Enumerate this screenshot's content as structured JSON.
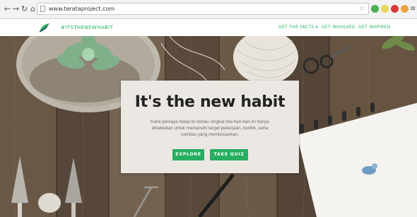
{
  "browser": {
    "url": "www.terataproject.com"
  },
  "header": {
    "brand": "#ITSTHENEWHABIT",
    "nav": [
      "GET THE FACTS ▾",
      "GET INVOLVED",
      "GET INSPIRED"
    ]
  },
  "hero": {
    "title": "It's the new habit",
    "body_lines": [
      "Kami percaya hidup ini terlalu singkat bila hari-hari ini hanya",
      "dihabiskan untuk memenuhi target pekerjaan, konflik, serta",
      "rutinitas yang membosankan."
    ],
    "explore_label": "EXPLORE",
    "quiz_label": "TAKE QUIZ"
  },
  "icons": {
    "back": "back-arrow-icon",
    "forward": "forward-arrow-icon",
    "reload": "reload-icon",
    "home": "home-icon",
    "bookmark": "star-icon",
    "menu": "menu-icon"
  },
  "colors": {
    "accent": "#27ae60",
    "card": "#ebe8e3"
  }
}
